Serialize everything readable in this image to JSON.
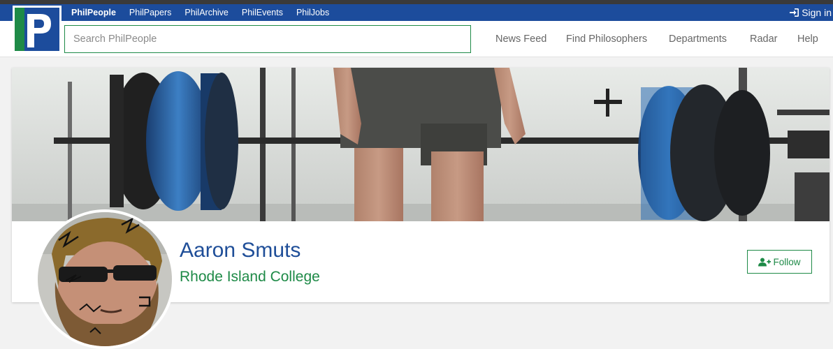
{
  "topnav": {
    "links": [
      {
        "label": "PhilPeople",
        "active": true
      },
      {
        "label": "PhilPapers",
        "active": false
      },
      {
        "label": "PhilArchive",
        "active": false
      },
      {
        "label": "PhilEvents",
        "active": false
      },
      {
        "label": "PhilJobs",
        "active": false
      }
    ],
    "sign_in_label": "Sign in",
    "sign_in_icon": "sign-in-icon"
  },
  "search": {
    "placeholder": "Search PhilPeople",
    "value": ""
  },
  "mainnav": {
    "items": [
      "News Feed",
      "Find Philosophers",
      "Departments",
      "Radar",
      "Help"
    ]
  },
  "profile": {
    "name": "Aaron Smuts",
    "affiliation": "Rhode Island College",
    "follow_label": "Follow",
    "follow_icon": "user-plus-icon"
  },
  "colors": {
    "brand_blue": "#1c4c9c",
    "accent_green": "#1e8a47",
    "name_blue": "#1f4e98"
  }
}
